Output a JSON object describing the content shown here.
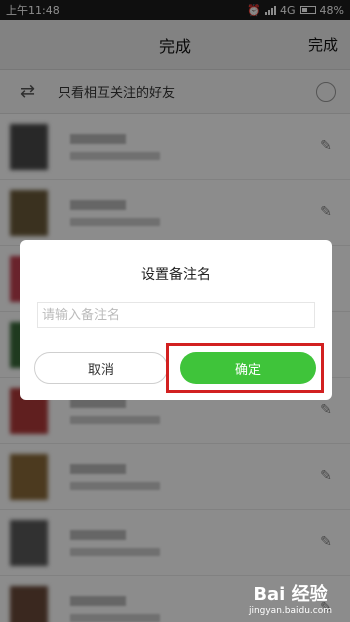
{
  "status": {
    "time": "上午11:48",
    "network": "4G",
    "battery": "48%"
  },
  "navbar": {
    "title": "完成",
    "done": "完成"
  },
  "filter": {
    "label": "只看相互关注的好友"
  },
  "list_count": 8,
  "dialog": {
    "title": "设置备注名",
    "input_placeholder": "请输入备注名",
    "input_value": "",
    "cancel": "取消",
    "confirm": "确定"
  },
  "colors": {
    "accent": "#3fc43a",
    "highlight": "#d22020"
  },
  "watermark": {
    "line1": "Bai 经验",
    "line2": "jingyan.baidu.com"
  }
}
